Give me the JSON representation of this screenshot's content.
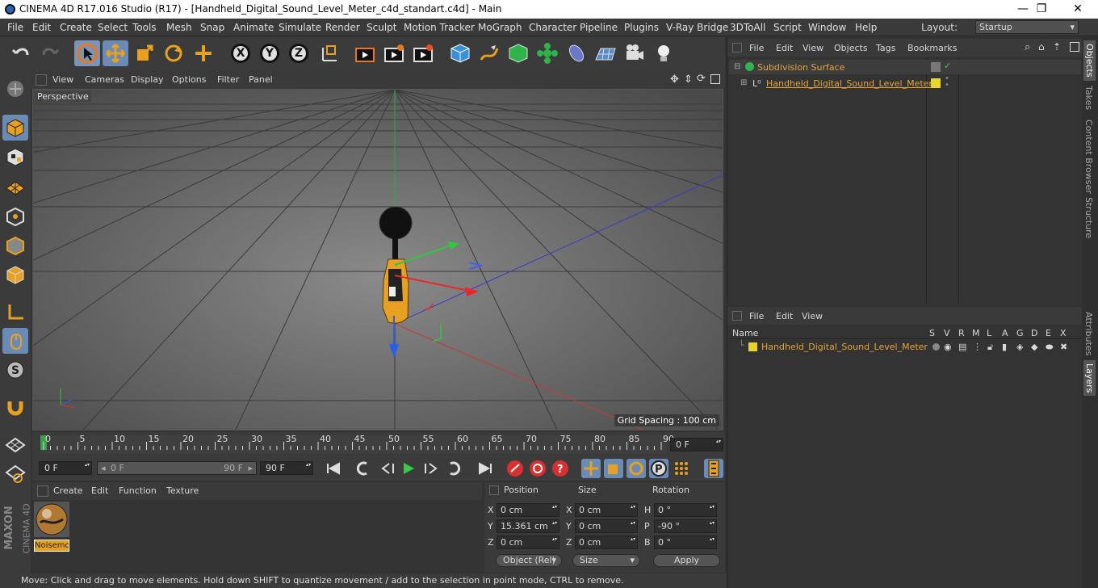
{
  "window": {
    "title": "CINEMA 4D R17.016 Studio (R17) - [Handheld_Digital_Sound_Level_Meter_c4d_standart.c4d] - Main",
    "minimize": "—",
    "maximize": "❐",
    "close": "✕"
  },
  "menubar": [
    "File",
    "Edit",
    "Create",
    "Select",
    "Tools",
    "Mesh",
    "Snap",
    "Animate",
    "Simulate",
    "Render",
    "Sculpt",
    "Motion Tracker",
    "MoGraph",
    "Character",
    "Pipeline",
    "Plugins",
    "V-Ray Bridge",
    "3DToAll",
    "Script",
    "Window",
    "Help"
  ],
  "layout": {
    "label": "Layout:",
    "value": "Startup"
  },
  "toolbar": {
    "axis_x": "X",
    "axis_y": "Y",
    "axis_z": "Z"
  },
  "viewport": {
    "menu": [
      "View",
      "Cameras",
      "Display",
      "Options",
      "Filter",
      "Panel"
    ],
    "camera_label": "Perspective",
    "grid_spacing": "Grid Spacing : 100 cm"
  },
  "timeline": {
    "ticks": [
      "0",
      "5",
      "10",
      "15",
      "20",
      "25",
      "30",
      "35",
      "40",
      "45",
      "50",
      "55",
      "60",
      "65",
      "70",
      "75",
      "80",
      "85",
      "90"
    ],
    "current_frame_field": "0 F",
    "start_field": "0 F",
    "range_start": "0 F",
    "range_end": "90 F",
    "end_field": "90 F"
  },
  "materials": {
    "menu": [
      "Create",
      "Edit",
      "Function",
      "Texture"
    ],
    "items": [
      {
        "label": "Noisemo"
      }
    ]
  },
  "coordinates": {
    "headers": {
      "position": "Position",
      "size": "Size",
      "rotation": "Rotation"
    },
    "rows": [
      {
        "axis": "X",
        "pos": "0 cm",
        "size_axis": "X",
        "size": "0 cm",
        "rot_axis": "H",
        "rot": "0 °"
      },
      {
        "axis": "Y",
        "pos": "15.361 cm",
        "size_axis": "Y",
        "size": "0 cm",
        "rot_axis": "P",
        "rot": "-90 °"
      },
      {
        "axis": "Z",
        "pos": "0 cm",
        "size_axis": "Z",
        "size": "0 cm",
        "rot_axis": "B",
        "rot": "0 °"
      }
    ],
    "mode_dropdown": "Object (Rel)",
    "size_dropdown": "Size",
    "apply": "Apply"
  },
  "status": "Move: Click and drag to move elements. Hold down SHIFT to quantize movement / add to the selection in point mode, CTRL to remove.",
  "objects_panel": {
    "menu": [
      "File",
      "Edit",
      "View",
      "Objects",
      "Tags",
      "Bookmarks"
    ],
    "tree": [
      {
        "name": "Subdivision Surface"
      },
      {
        "name": "Handheld_Digital_Sound_Level_Meter"
      }
    ]
  },
  "layers_panel": {
    "menu": [
      "File",
      "Edit",
      "View"
    ],
    "columns": [
      "Name",
      "S",
      "V",
      "R",
      "M",
      "L",
      "A",
      "G",
      "D",
      "E",
      "X"
    ],
    "rows": [
      {
        "name": "Handheld_Digital_Sound_Level_Meter",
        "color": "#e8d42a"
      }
    ]
  },
  "right_tabs": [
    "Objects",
    "Takes",
    "Content Browser",
    "Structure",
    "Attributes",
    "Layers"
  ],
  "brand": {
    "maxon": "MAXON",
    "product": "CINEMA 4D"
  },
  "colors": {
    "accent_orange": "#e8a33a",
    "selection_blue": "#6a8bb5",
    "layer_yellow": "#e8d42a"
  }
}
